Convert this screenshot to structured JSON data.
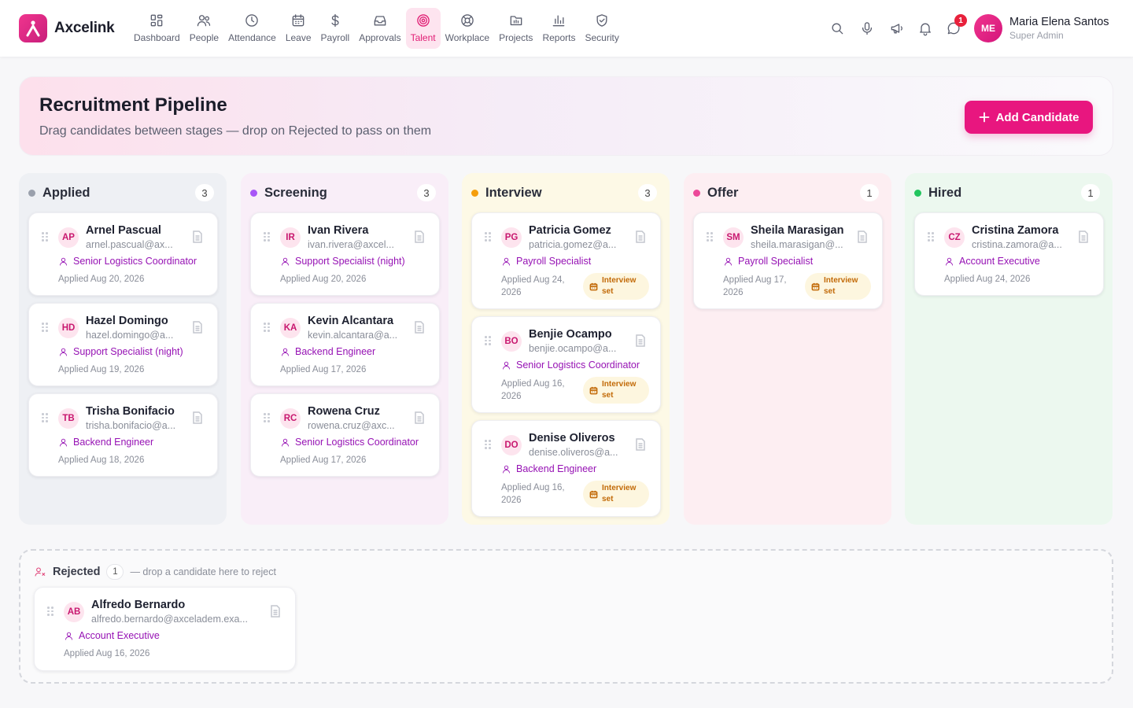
{
  "brand": {
    "name": "Axcelink",
    "accent": "#e8167f"
  },
  "nav": [
    {
      "id": "dashboard",
      "label": "Dashboard",
      "icon": "dashboard-icon"
    },
    {
      "id": "people",
      "label": "People",
      "icon": "people-icon"
    },
    {
      "id": "attendance",
      "label": "Attendance",
      "icon": "clock-icon"
    },
    {
      "id": "leave",
      "label": "Leave",
      "icon": "calendar-icon"
    },
    {
      "id": "payroll",
      "label": "Payroll",
      "icon": "dollar-icon"
    },
    {
      "id": "approvals",
      "label": "Approvals",
      "icon": "inbox-icon"
    },
    {
      "id": "talent",
      "label": "Talent",
      "icon": "target-icon",
      "active": true
    },
    {
      "id": "workplace",
      "label": "Workplace",
      "icon": "lifebuoy-icon"
    },
    {
      "id": "projects",
      "label": "Projects",
      "icon": "folder-icon"
    },
    {
      "id": "reports",
      "label": "Reports",
      "icon": "bar-chart-icon"
    },
    {
      "id": "security",
      "label": "Security",
      "icon": "shield-icon"
    }
  ],
  "user": {
    "initials": "ME",
    "name": "Maria Elena Santos",
    "role": "Super Admin",
    "notifications": "1"
  },
  "header": {
    "title": "Recruitment Pipeline",
    "subtitle": "Drag candidates between stages — drop on Rejected to pass on them",
    "add_label": "Add Candidate"
  },
  "columns": [
    {
      "title": "Applied",
      "count": "3",
      "dot": "#9aa0ac",
      "bg": "#eef0f4"
    },
    {
      "title": "Screening",
      "count": "3",
      "dot": "#a855f7",
      "bg": "#f9eef8"
    },
    {
      "title": "Interview",
      "count": "3",
      "dot": "#f59e0b",
      "bg": "#fdf9e6"
    },
    {
      "title": "Offer",
      "count": "1",
      "dot": "#ec4899",
      "bg": "#fdeef2"
    },
    {
      "title": "Hired",
      "count": "1",
      "dot": "#22c55e",
      "bg": "#ecf8ef"
    }
  ],
  "cards": {
    "applied": [
      {
        "initials": "AP",
        "name": "Arnel Pascual",
        "email": "arnel.pascual@ax...",
        "role": "Senior Logistics Coordinator",
        "applied": "Applied Aug 20, 2026"
      },
      {
        "initials": "HD",
        "name": "Hazel Domingo",
        "email": "hazel.domingo@a...",
        "role": "Support Specialist (night)",
        "applied": "Applied Aug 19, 2026"
      },
      {
        "initials": "TB",
        "name": "Trisha Bonifacio",
        "email": "trisha.bonifacio@a...",
        "role": "Backend Engineer",
        "applied": "Applied Aug 18, 2026"
      }
    ],
    "screening": [
      {
        "initials": "IR",
        "name": "Ivan Rivera",
        "email": "ivan.rivera@axcel...",
        "role": "Support Specialist (night)",
        "applied": "Applied Aug 20, 2026"
      },
      {
        "initials": "KA",
        "name": "Kevin Alcantara",
        "email": "kevin.alcantara@a...",
        "role": "Backend Engineer",
        "applied": "Applied Aug 17, 2026"
      },
      {
        "initials": "RC",
        "name": "Rowena Cruz",
        "email": "rowena.cruz@axc...",
        "role": "Senior Logistics Coordinator",
        "applied": "Applied Aug 17, 2026"
      }
    ],
    "interview": [
      {
        "initials": "PG",
        "name": "Patricia Gomez",
        "email": "patricia.gomez@a...",
        "role": "Payroll Specialist",
        "applied": "Applied Aug 24, 2026",
        "status": "Interview set"
      },
      {
        "initials": "BO",
        "name": "Benjie Ocampo",
        "email": "benjie.ocampo@a...",
        "role": "Senior Logistics Coordinator",
        "applied": "Applied Aug 16, 2026",
        "status": "Interview set"
      },
      {
        "initials": "DO",
        "name": "Denise Oliveros",
        "email": "denise.oliveros@a...",
        "role": "Backend Engineer",
        "applied": "Applied Aug 16, 2026",
        "status": "Interview set"
      }
    ],
    "offer": [
      {
        "initials": "SM",
        "name": "Sheila Marasigan",
        "email": "sheila.marasigan@...",
        "role": "Payroll Specialist",
        "applied": "Applied Aug 17, 2026",
        "status": "Interview set"
      }
    ],
    "hired": [
      {
        "initials": "CZ",
        "name": "Cristina Zamora",
        "email": "cristina.zamora@a...",
        "role": "Account Executive",
        "applied": "Applied Aug 24, 2026"
      }
    ]
  },
  "rejected": {
    "title": "Rejected",
    "count": "1",
    "hint": "— drop a candidate here to reject",
    "card": {
      "initials": "AB",
      "name": "Alfredo Bernardo",
      "email": "alfredo.bernardo@axceladem.exa...",
      "role": "Account Executive",
      "applied": "Applied Aug 16, 2026"
    }
  }
}
